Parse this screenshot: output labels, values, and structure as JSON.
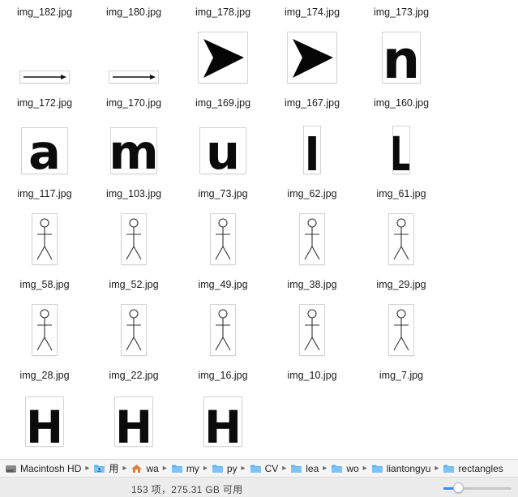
{
  "files": [
    {
      "name": "img_182.jpg",
      "thumb": "none"
    },
    {
      "name": "img_180.jpg",
      "thumb": "none"
    },
    {
      "name": "img_178.jpg",
      "thumb": "none"
    },
    {
      "name": "img_174.jpg",
      "thumb": "none"
    },
    {
      "name": "img_173.jpg",
      "thumb": "none"
    },
    {
      "name": "img_172.jpg",
      "thumb": "arrow"
    },
    {
      "name": "img_170.jpg",
      "thumb": "arrow"
    },
    {
      "name": "img_169.jpg",
      "thumb": "triangle"
    },
    {
      "name": "img_167.jpg",
      "thumb": "triangle"
    },
    {
      "name": "img_160.jpg",
      "thumb": "letter",
      "glyph": "n"
    },
    {
      "name": "img_117.jpg",
      "thumb": "letter",
      "glyph": "a"
    },
    {
      "name": "img_103.jpg",
      "thumb": "letter",
      "glyph": "m"
    },
    {
      "name": "img_73.jpg",
      "thumb": "letter",
      "glyph": "u"
    },
    {
      "name": "img_62.jpg",
      "thumb": "letter",
      "glyph": "l"
    },
    {
      "name": "img_61.jpg",
      "thumb": "letter",
      "glyph": "L"
    },
    {
      "name": "img_58.jpg",
      "thumb": "stickman"
    },
    {
      "name": "img_52.jpg",
      "thumb": "stickman"
    },
    {
      "name": "img_49.jpg",
      "thumb": "stickman"
    },
    {
      "name": "img_38.jpg",
      "thumb": "stickman"
    },
    {
      "name": "img_29.jpg",
      "thumb": "stickman"
    },
    {
      "name": "img_28.jpg",
      "thumb": "stickman"
    },
    {
      "name": "img_22.jpg",
      "thumb": "stickman"
    },
    {
      "name": "img_16.jpg",
      "thumb": "stickman"
    },
    {
      "name": "img_10.jpg",
      "thumb": "stickman"
    },
    {
      "name": "img_7.jpg",
      "thumb": "stickman"
    },
    {
      "name": "",
      "thumb": "letter",
      "glyph": "H"
    },
    {
      "name": "",
      "thumb": "letter",
      "glyph": "H"
    },
    {
      "name": "",
      "thumb": "letter",
      "glyph": "H"
    }
  ],
  "path_bar": {
    "items": [
      {
        "label": "Macintosh HD",
        "icon": "hard-drive-icon"
      },
      {
        "label": "用",
        "icon": "user-folder-icon"
      },
      {
        "label": "wa",
        "icon": "home-icon"
      },
      {
        "label": "my",
        "icon": "folder-icon"
      },
      {
        "label": "py",
        "icon": "folder-icon"
      },
      {
        "label": "CV",
        "icon": "folder-icon"
      },
      {
        "label": "lea",
        "icon": "folder-icon"
      },
      {
        "label": "wo",
        "icon": "folder-icon"
      },
      {
        "label": "liantongyu",
        "icon": "folder-icon"
      },
      {
        "label": "rectangles",
        "icon": "folder-icon"
      }
    ],
    "separator": "▸"
  },
  "status": {
    "text": "153 项，275.31 GB 可用",
    "icon_size_fraction": 0.22
  },
  "colors": {
    "folder": "#5fb0f0",
    "accent": "#3b8bf7"
  }
}
